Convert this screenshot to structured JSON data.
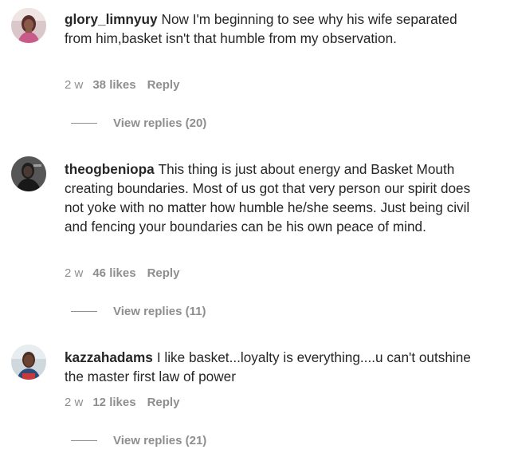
{
  "comments": [
    {
      "username": "glory_limnyuy",
      "text": "Now I'm beginning to see why his wife separated from him,basket isn't that humble from my observation.",
      "age": "2 w",
      "likes": "38 likes",
      "reply": "Reply",
      "view_replies": "View replies (20)",
      "avatar_icon": "user-avatar-photo"
    },
    {
      "username": "theogbeniopa",
      "text": "This thing is just about energy and Basket Mouth creating boundaries. Most of us got that very person our spirit does not yoke with no matter how humble he/she seems. Just being civil and fencing your boundaries can be his own peace of mind.",
      "age": "2 w",
      "likes": "46 likes",
      "reply": "Reply",
      "view_replies": "View replies (11)",
      "avatar_icon": "user-avatar-photo"
    },
    {
      "username": "kazzahadams",
      "text": "I like basket...loyalty is everything....u can't outshine the master first law of power",
      "age": "2 w",
      "likes": "12 likes",
      "reply": "Reply",
      "view_replies": "View replies (21)",
      "avatar_icon": "user-avatar-photo"
    }
  ],
  "colors": {
    "text": "#262626",
    "secondary": "#8e8e8e",
    "background": "#ffffff"
  }
}
